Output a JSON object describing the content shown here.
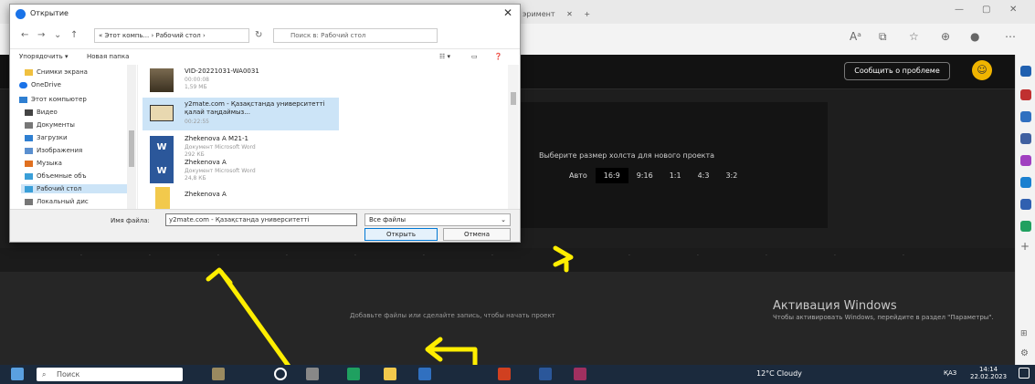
{
  "browser": {
    "tab_text": "эримент",
    "tab_close": "✕",
    "new_tab": "+",
    "minimize": "—",
    "maximize": "▢",
    "close": "✕"
  },
  "app": {
    "report_button": "Сообщить о проблеме",
    "canvas_title": "Выберите размер холста для нового проекта",
    "ratios": [
      "Авто",
      "16:9",
      "9:16",
      "1:1",
      "4:3",
      "3:2"
    ],
    "selected_ratio": "16:9",
    "timeline_hint": "Добавьте файлы или сделайте запись, чтобы начать проект",
    "activation_title": "Активация Windows",
    "activation_body": "Чтобы активировать Windows, перейдите в раздел \"Параметры\"."
  },
  "dialog": {
    "title": "Открытие",
    "path": "« Этот компь... › Рабочий стол ›",
    "search_placeholder": "Поиск в: Рабочий стол",
    "organize": "Упорядочить ▾",
    "new_folder": "Новая папка",
    "tree": [
      {
        "label": "Снимки экрана",
        "color": "#f0c040"
      },
      {
        "label": "OneDrive",
        "color": "#1a73e8"
      },
      {
        "label": "Этот компьютер",
        "color": "#2f7fd1"
      },
      {
        "label": "Видео",
        "color": "#444"
      },
      {
        "label": "Документы",
        "color": "#777"
      },
      {
        "label": "Загрузки",
        "color": "#2f7fd1"
      },
      {
        "label": "Изображения",
        "color": "#5a8fcf"
      },
      {
        "label": "Музыка",
        "color": "#e07020"
      },
      {
        "label": "Объемные объ",
        "color": "#3a9fd8"
      },
      {
        "label": "Рабочий стол",
        "color": "#3a9fd8"
      },
      {
        "label": "Локальный дис",
        "color": "#777"
      }
    ],
    "files": [
      {
        "name": "VID-20221031-WA0031",
        "meta1": "00:00:08",
        "meta2": "1,59 МБ"
      },
      {
        "name": "y2mate.com - Қазақстанда университетті қалай таңдаймыз...",
        "meta1": "00:22:55",
        "meta2": ""
      },
      {
        "name": "Zhekenova A M21-1",
        "meta1": "Документ Microsoft Word",
        "meta2": "292 КБ"
      },
      {
        "name": "Zhekenova A",
        "meta1": "Документ Microsoft Word",
        "meta2": "24,8 КБ"
      },
      {
        "name": "Zhekenova A",
        "meta1": "",
        "meta2": ""
      }
    ],
    "filename_label": "Имя файла:",
    "filename_value": "y2mate.com - Қазақстанда университетті",
    "filter": "Все файлы",
    "open_button": "Открыть",
    "cancel_button": "Отмена"
  },
  "taskbar": {
    "search": "Поиск",
    "weather": "12°C Cloudy",
    "lang": "ҚАЗ",
    "time": "14:14",
    "date": "22.02.2023"
  },
  "colors": {
    "annotation": "#ffee00",
    "accent": "#0078d4"
  }
}
